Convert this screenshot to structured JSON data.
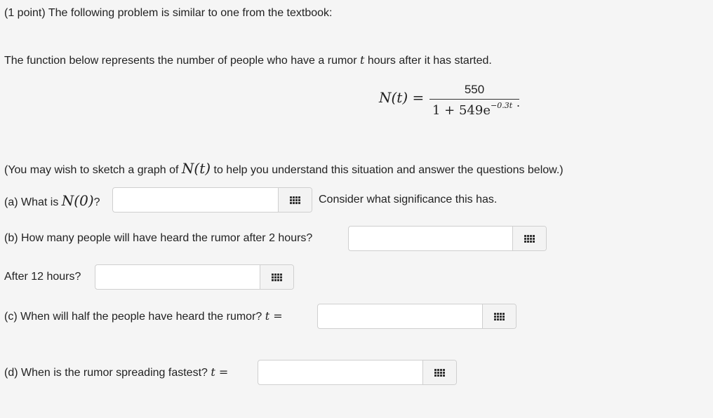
{
  "header": {
    "intro": "(1 point) The following problem is similar to one from the textbook:"
  },
  "problem": {
    "statement_before": "The function below represents the number of people who have a rumor",
    "statement_var": "t",
    "statement_after": "hours after it has started."
  },
  "formula": {
    "lhs": "N(t) =",
    "numerator": "550",
    "denominator_base": "1 + 549e",
    "denominator_exp": "−0.3t",
    "trailing": "."
  },
  "hint": {
    "before": "(You may wish to sketch a graph of",
    "math": "N(t)",
    "after": "to help you understand this situation and answer the questions below.)"
  },
  "questions": {
    "a": {
      "before": "(a) What is",
      "math": "N(0)",
      "after": "?",
      "note": "Consider what significance this has.",
      "value": ""
    },
    "b": {
      "label": "(b) How many people will have heard the rumor after 2 hours?",
      "value": ""
    },
    "b2": {
      "label": "After 12 hours?",
      "value": ""
    },
    "c": {
      "label": "(c) When will half the people have heard the rumor?",
      "math": "t =",
      "value": ""
    },
    "d": {
      "label": "(d) When is the rumor spreading fastest?",
      "math": "t =",
      "value": ""
    }
  },
  "icons": {
    "keyboard_button": "equation-editor-grid-icon"
  }
}
